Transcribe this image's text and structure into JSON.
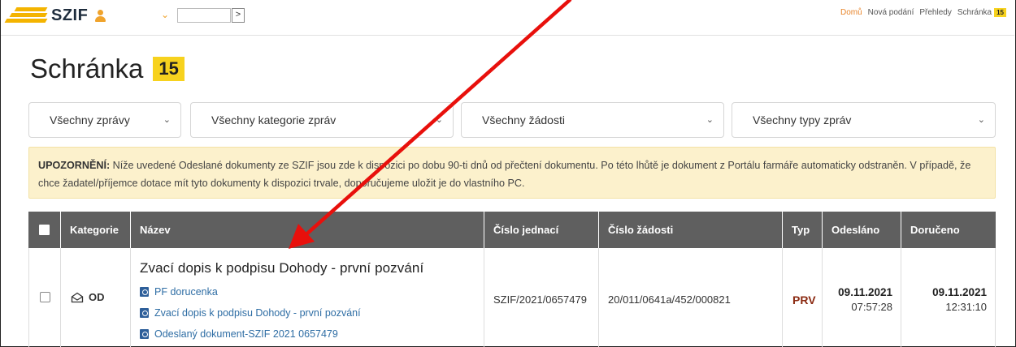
{
  "header": {
    "logo_text": "SZIF",
    "nav": {
      "home": "Domů",
      "new": "Nová podání",
      "overview": "Přehledy",
      "inbox": "Schránka",
      "inbox_count": "15"
    }
  },
  "page": {
    "title": "Schránka",
    "count": "15"
  },
  "filters": {
    "messages": "Všechny zprávy",
    "categories": "Všechny kategorie zpráv",
    "requests": "Všechny žádosti",
    "types": "Všechny typy zpráv"
  },
  "warning": {
    "label": "UPOZORNĚNÍ:",
    "text": " Níže uvedené Odeslané dokumenty ze SZIF jsou zde k dispozici po dobu 90-ti dnů od přečtení dokumentu. Po této lhůtě je dokument z Portálu farmáře automaticky odstraněn. V případě, že chce žadatel/příjemce dotace mít tyto dokumenty k dispozici trvale, doporučujeme uložit je do vlastního PC."
  },
  "table": {
    "headers": {
      "category": "Kategorie",
      "name": "Název",
      "ref_number": "Číslo jednací",
      "request_number": "Číslo žádosti",
      "type": "Typ",
      "sent": "Odesláno",
      "delivered": "Doručeno"
    },
    "rows": [
      {
        "category": "OD",
        "title": "Zvací dopis k podpisu Dohody - první pozvání",
        "documents": [
          "PF dorucenka",
          "Zvací dopis k podpisu Dohody - první pozvání",
          "Odeslaný dokument-SZIF 2021 0657479"
        ],
        "ref_number": "SZIF/2021/0657479",
        "request_number": "20/011/0641a/452/000821",
        "type": "PRV",
        "sent_date": "09.11.2021",
        "sent_time": "07:57:28",
        "delivered_date": "09.11.2021",
        "delivered_time": "12:31:10"
      }
    ]
  },
  "colors": {
    "accent_yellow": "#f7d21e",
    "header_bg": "#5f5f5f",
    "warning_bg": "#fcf1cc",
    "link": "#2e6da4",
    "type_text": "#8b2a12",
    "arrow": "#e8100c"
  }
}
